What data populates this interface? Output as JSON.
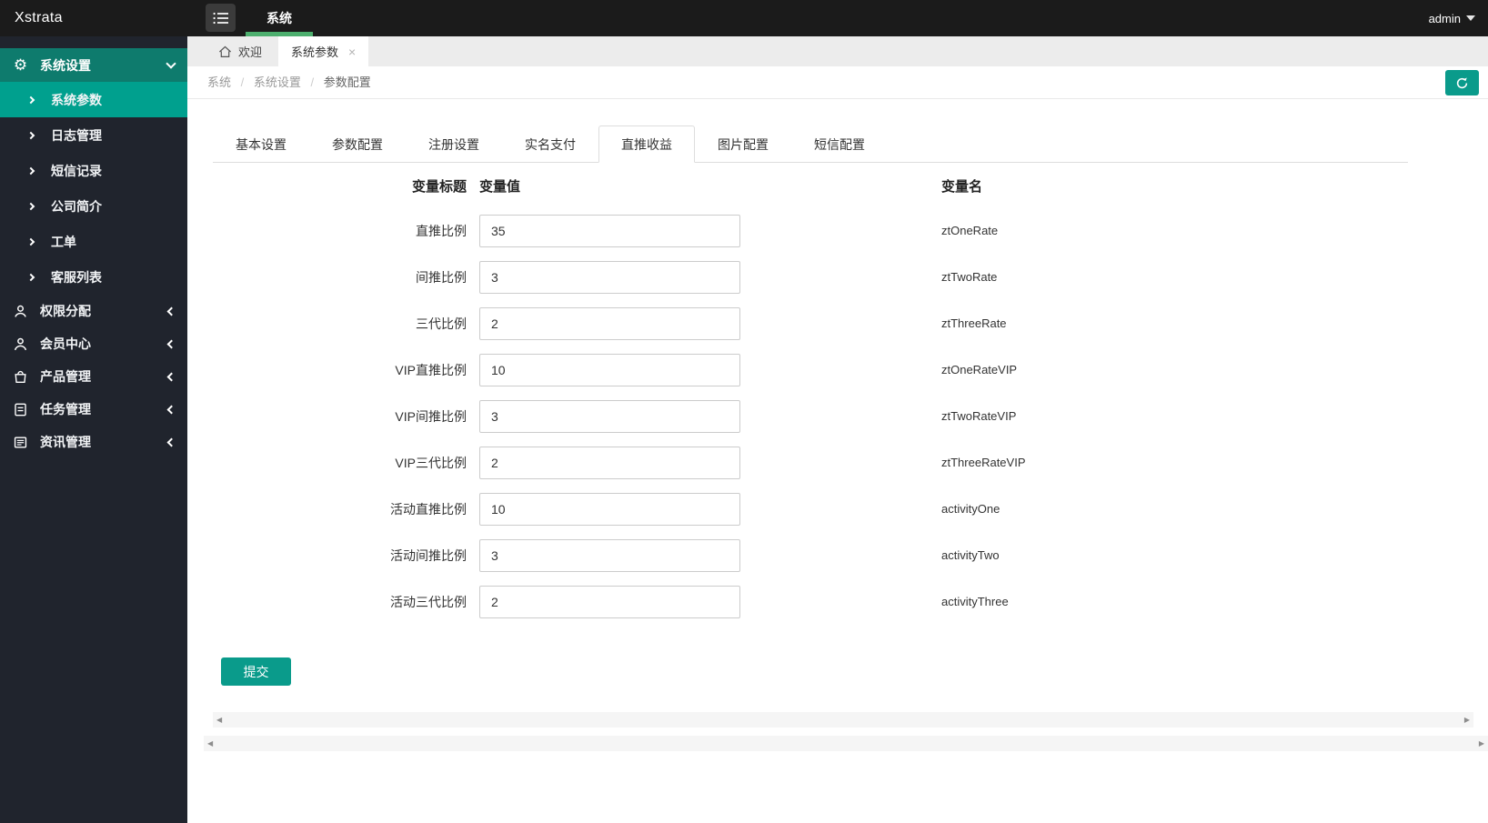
{
  "topbar": {
    "logo": "Xstrata",
    "nav_item": "系统",
    "user": "admin"
  },
  "sidebar": {
    "section": {
      "label": "系统设置"
    },
    "sub_items": [
      {
        "label": "系统参数",
        "active": true
      },
      {
        "label": "日志管理"
      },
      {
        "label": "短信记录"
      },
      {
        "label": "公司简介"
      },
      {
        "label": "工单"
      },
      {
        "label": "客服列表"
      }
    ],
    "items": [
      {
        "label": "权限分配",
        "icon": "user-icon"
      },
      {
        "label": "会员中心",
        "icon": "member-icon"
      },
      {
        "label": "产品管理",
        "icon": "product-bag-icon"
      },
      {
        "label": "任务管理",
        "icon": "task-file-icon"
      },
      {
        "label": "资讯管理",
        "icon": "news-book-icon"
      }
    ]
  },
  "toptabs": {
    "welcome": "欢迎",
    "current": "系统参数"
  },
  "breadcrumb": {
    "separator": "/",
    "items": [
      "系统",
      "系统设置",
      "参数配置"
    ]
  },
  "inner_tabs": [
    {
      "label": "基本设置"
    },
    {
      "label": "参数配置"
    },
    {
      "label": "注册设置"
    },
    {
      "label": "实名支付"
    },
    {
      "label": "直推收益",
      "active": true
    },
    {
      "label": "图片配置"
    },
    {
      "label": "短信配置"
    }
  ],
  "form": {
    "headers": {
      "title": "变量标题",
      "value": "变量值",
      "name": "变量名"
    },
    "rows": [
      {
        "title": "直推比例",
        "value": "35",
        "name": "ztOneRate"
      },
      {
        "title": "间推比例",
        "value": "3",
        "name": "ztTwoRate"
      },
      {
        "title": "三代比例",
        "value": "2",
        "name": "ztThreeRate"
      },
      {
        "title": "VIP直推比例",
        "value": "10",
        "name": "ztOneRateVIP"
      },
      {
        "title": "VIP间推比例",
        "value": "3",
        "name": "ztTwoRateVIP"
      },
      {
        "title": "VIP三代比例",
        "value": "2",
        "name": "ztThreeRateVIP"
      },
      {
        "title": "活动直推比例",
        "value": "10",
        "name": "activityOne"
      },
      {
        "title": "活动间推比例",
        "value": "3",
        "name": "activityTwo"
      },
      {
        "title": "活动三代比例",
        "value": "2",
        "name": "activityThree"
      }
    ],
    "submit_label": "提交"
  },
  "icons": {
    "close": "×",
    "gear": "⚙",
    "arrow_left": "◀",
    "arrow_right": "▶"
  },
  "colors": {
    "topbar_bg": "#1b1b1b",
    "nav_underline_green": "#4daf6e",
    "sidebar_bg": "#20242d",
    "section_header_teal": "#0e7b6d",
    "active_item_teal": "#00a08e",
    "accent_teal": "#0a9b8b",
    "tabstrip_bg": "#ececec"
  }
}
